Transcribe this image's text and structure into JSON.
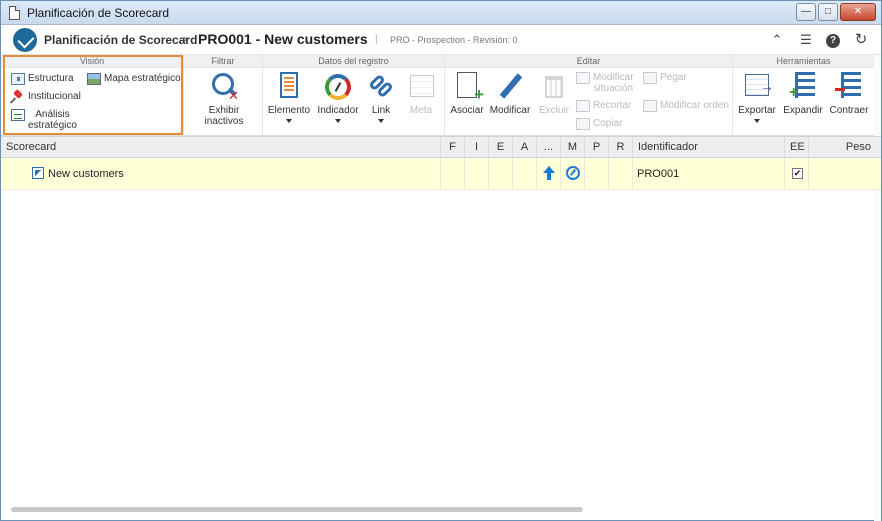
{
  "window": {
    "title": "Planificación de Scorecard"
  },
  "header": {
    "app_name": "Planificación de Scorecard",
    "breadcrumb_separator": "›",
    "record_title": "PRO001 - New customers",
    "separator": "|",
    "record_subtitle": "PRO - Prospection - Revisión: 0"
  },
  "ribbon": {
    "vision": {
      "title": "Visión",
      "estructura": "Estructura",
      "mapa": "Mapa estratégico",
      "institucional": "Institucional",
      "analisis_line1": "Análisis",
      "analisis_line2": "estratégico"
    },
    "filtrar": {
      "title": "Filtrar",
      "exhibir": "Exhibir inactivos"
    },
    "datos": {
      "title": "Datos del registro",
      "elemento": "Elemento",
      "indicador": "Indicador",
      "link": "Link",
      "meta": "Meta"
    },
    "editar": {
      "title": "Editar",
      "asociar": "Asociar",
      "modificar": "Modificar",
      "excluir": "Excluir",
      "modificar_situacion_1": "Modificar",
      "modificar_situacion_2": "situación",
      "recortar": "Recortar",
      "copiar": "Copiar",
      "pegar": "Pegar",
      "modificar_orden": "Modificar orden"
    },
    "herramientas": {
      "title": "Herramientas",
      "exportar": "Exportar",
      "expandir": "Expandir",
      "contraer": "Contraer"
    }
  },
  "grid": {
    "columns": [
      "Scorecard",
      "F",
      "I",
      "E",
      "A",
      "...",
      "M",
      "P",
      "R",
      "Identificador",
      "EE",
      "Peso"
    ],
    "rows": [
      {
        "scorecard": "New customers",
        "identificador": "PRO001",
        "ee_checked": "✔"
      }
    ]
  },
  "colors": {
    "accent": "#2f6eb0",
    "highlight_border": "#e88b38",
    "row_selected": "#ffffd8"
  }
}
